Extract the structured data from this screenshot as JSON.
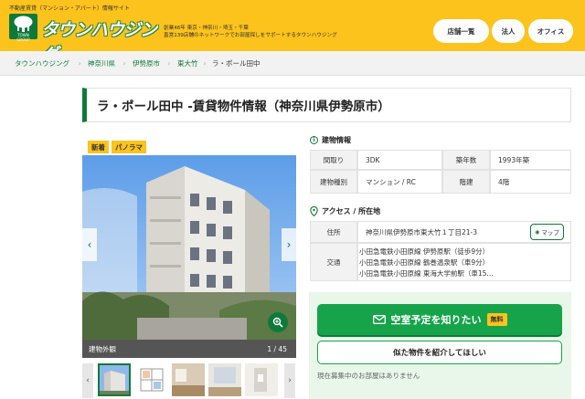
{
  "header": {
    "tagline": "不動産賃貸（マンション・アパート）情報サイト",
    "logo_text": "タウンハウジング",
    "logo_sub": "TOWN GROUP",
    "desc_line1": "創業46年 東京・神奈川・埼玉・千葉",
    "desc_line2": "直営139店舗のネットワークでお部屋探しをサポートするタウンハウジング",
    "nav": [
      "店舗一覧",
      "法人",
      "オフィス"
    ],
    "brand_yellow": "#fcc31c",
    "brand_green": "#0e7a3a"
  },
  "breadcrumb": [
    "タウンハウジング",
    "神奈川県",
    "伊勢原市",
    "東大竹",
    "ラ・ポール田中"
  ],
  "page_title": "ラ・ポール田中 -賃貸物件情報（神奈川県伊勢原市）",
  "gallery": {
    "badges": [
      "新着",
      "パノラマ"
    ],
    "caption": "建物外観",
    "counter": "1 / 45",
    "photo_icon": "zoom-in-icon"
  },
  "building_info": {
    "heading": "建物情報",
    "rows": [
      {
        "k1": "間取り",
        "v1": "3DK",
        "k2": "築年数",
        "v2": "1993年築"
      },
      {
        "k1": "建物種別",
        "v1": "マンション / RC",
        "k2": "階建",
        "v2": "4階"
      }
    ]
  },
  "access": {
    "heading": "アクセス / 所在地",
    "address_label": "住所",
    "address": "神奈川県伊勢原市東大竹１丁目21-3",
    "map_label": "マップ",
    "traffic_label": "交通",
    "traffic": [
      "小田急電鉄小田原線 伊勢原駅（徒歩9分）",
      "小田急電鉄小田原線 鶴巻温泉駅（車9分）",
      "小田急電鉄小田原線 東海大学前駅（車15…"
    ]
  },
  "cta": {
    "main_label": "空室予定を知りたい",
    "free_label": "無料",
    "sub_label": "似た物件を紹介してほしい",
    "note": "現在募集中のお部屋はありません"
  }
}
